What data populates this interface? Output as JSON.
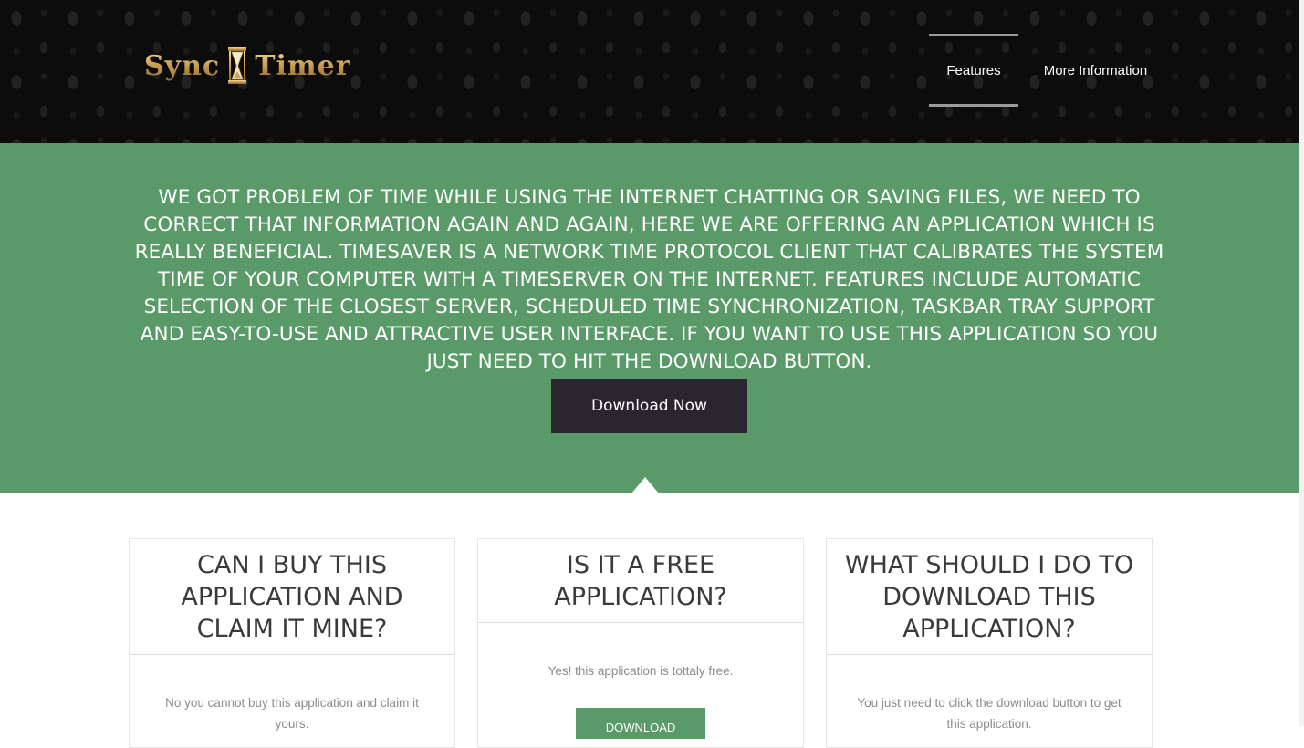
{
  "header": {
    "logo": {
      "word_left": "Sync",
      "word_right": "Timer",
      "icon": "hourglass-icon"
    },
    "nav": [
      {
        "label": "Features",
        "active": true
      },
      {
        "label": "More Information",
        "active": false
      }
    ]
  },
  "hero": {
    "text": "We got problem of time while using the internet chatting or saving files, we need to correct that information again and again, here we are offering an application which is really beneficial. TimeSaver is a network time protocol client that calibrates the system time of your computer with a timeserver on the Internet. Features include automatic selection of the closest server, scheduled time synchronization, taskbar tray support and easy-to-use and attractive user interface. If you want to use this application so you just need to hit the download button.",
    "button_label": "Download Now"
  },
  "cards": [
    {
      "title": "Can I buy this application and claim it mine?",
      "text": "No you cannot buy this application and claim it yours."
    },
    {
      "title": "Is it a free application?",
      "text": "Yes! this application is tottaly free.",
      "button_label": "DOWNLOAD"
    },
    {
      "title": "What should I do to download this application?",
      "text": "You just need to click the download button to get this application."
    }
  ],
  "colors": {
    "hero_green": "#5a9a68",
    "dark_button": "#2b2530",
    "logo_gold": "#c9a55a"
  }
}
